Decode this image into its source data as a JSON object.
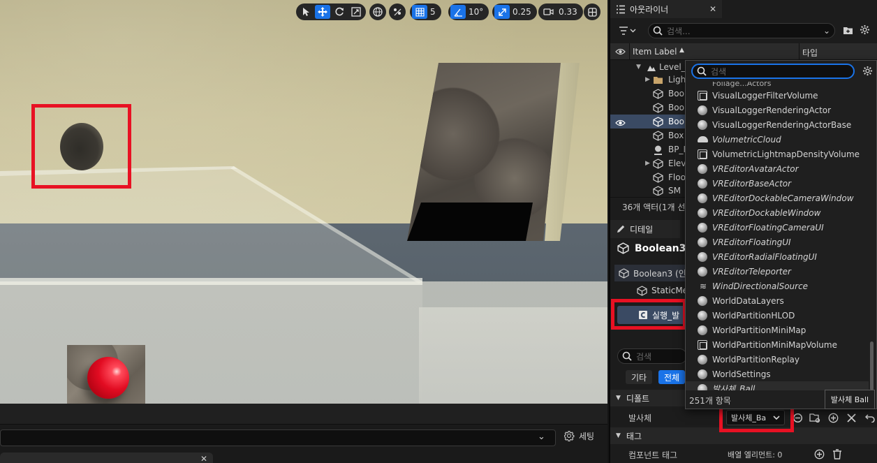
{
  "viewport": {
    "toolbar": {
      "grid_snap_value": "5",
      "rotation_snap_value": "10°",
      "scale_snap_value": "0.25",
      "camera_speed_value": "0.33"
    },
    "bottom": {
      "settings_label": "세팅"
    }
  },
  "outliner": {
    "tab_title": "아웃라이너",
    "search_placeholder": "검색...",
    "col_item_label": "Item Label",
    "col_type": "타입",
    "rows": [
      {
        "label": "Level_"
      },
      {
        "label": "Ligh"
      },
      {
        "label": "Bool"
      },
      {
        "label": "Bool"
      },
      {
        "label": "Bool"
      },
      {
        "label": "Box"
      },
      {
        "label": "BP_I"
      },
      {
        "label": "Elev"
      },
      {
        "label": "Floo"
      },
      {
        "label": "SM"
      }
    ],
    "status": "36개 액터(1개 선"
  },
  "details": {
    "tab_title": "디테일",
    "actor_name": "Boolean3",
    "component_root": "Boolean3 (인",
    "component_child": "StaticMe",
    "run_button": "실행_발",
    "search_placeholder": "검색",
    "filters": [
      "기타",
      "전체"
    ],
    "category_default": "디폴트",
    "prop_projectile_label": "발사체",
    "prop_projectile_value": "발사체_Ba",
    "category_tags": "태그",
    "prop_component_tags_label": "컴포넌트 태그",
    "prop_component_tags_value": "배열 엘리먼트: 0"
  },
  "dropdown": {
    "search_placeholder": "검색",
    "partial_top_item": "Foliage...Actors",
    "items": [
      {
        "label": "VisualLoggerFilterVolume",
        "icon": "volume",
        "italic": false
      },
      {
        "label": "VisualLoggerRenderingActor",
        "icon": "ball",
        "italic": false
      },
      {
        "label": "VisualLoggerRenderingActorBase",
        "icon": "ball",
        "italic": false
      },
      {
        "label": "VolumetricCloud",
        "icon": "cloud",
        "italic": true
      },
      {
        "label": "VolumetricLightmapDensityVolume",
        "icon": "volume",
        "italic": false
      },
      {
        "label": "VREditorAvatarActor",
        "icon": "ball",
        "italic": true
      },
      {
        "label": "VREditorBaseActor",
        "icon": "ball",
        "italic": true
      },
      {
        "label": "VREditorDockableCameraWindow",
        "icon": "ball",
        "italic": true
      },
      {
        "label": "VREditorDockableWindow",
        "icon": "ball",
        "italic": true
      },
      {
        "label": "VREditorFloatingCameraUI",
        "icon": "ball",
        "italic": true
      },
      {
        "label": "VREditorFloatingUI",
        "icon": "ball",
        "italic": true
      },
      {
        "label": "VREditorRadialFloatingUI",
        "icon": "ball",
        "italic": true
      },
      {
        "label": "VREditorTeleporter",
        "icon": "ball",
        "italic": true
      },
      {
        "label": "WindDirectionalSource",
        "icon": "wind",
        "italic": true
      },
      {
        "label": "WorldDataLayers",
        "icon": "ball",
        "italic": false
      },
      {
        "label": "WorldPartitionHLOD",
        "icon": "ball",
        "italic": false
      },
      {
        "label": "WorldPartitionMiniMap",
        "icon": "ball",
        "italic": false
      },
      {
        "label": "WorldPartitionMiniMapVolume",
        "icon": "volume",
        "italic": false
      },
      {
        "label": "WorldPartitionReplay",
        "icon": "ball",
        "italic": false
      },
      {
        "label": "WorldSettings",
        "icon": "ball",
        "italic": false
      },
      {
        "label": "발사체_Ball",
        "icon": "ball",
        "italic": true
      }
    ],
    "count": "251개 항목"
  },
  "tooltip": "발사체 Ball",
  "colors": {
    "accent": "#1a73e8",
    "highlight_box": "#e81123",
    "selection": "#3a4a63"
  }
}
